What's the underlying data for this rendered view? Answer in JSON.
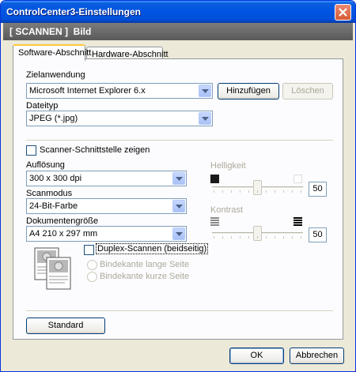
{
  "window": {
    "title": "ControlCenter3-Einstellungen",
    "close_icon": "close-icon"
  },
  "header": {
    "text": "[ SCANNEN ]  Bild"
  },
  "tabs": [
    {
      "label": "Software-Abschnitt",
      "active": true
    },
    {
      "label": "Hardware-Abschnitt",
      "active": false
    }
  ],
  "target_app": {
    "label": "Zielanwendung",
    "value": "Microsoft Internet Explorer 6.x",
    "add_button": "Hinzufügen",
    "delete_button": "Löschen"
  },
  "file_type": {
    "label": "Dateityp",
    "value": "JPEG (*.jpg)"
  },
  "show_scanner_interface": {
    "label": "Scanner-Schnittstelle zeigen",
    "checked": false
  },
  "resolution": {
    "label": "Auflösung",
    "value": "300 x 300 dpi"
  },
  "scan_mode": {
    "label": "Scanmodus",
    "value": "24-Bit-Farbe"
  },
  "document_size": {
    "label": "Dokumentengröße",
    "value": "A4 210 x 297 mm"
  },
  "brightness": {
    "label": "Helligkeit",
    "value": "50",
    "level": 0.5
  },
  "contrast": {
    "label": "Kontrast",
    "value": "50",
    "level": 0.5
  },
  "duplex": {
    "label": "Duplex-Scannen (beidseitig)",
    "checked": false,
    "options": [
      "Bindekante lange Seite",
      "Bindekante kurze Seite"
    ]
  },
  "buttons": {
    "default": "Standard",
    "ok": "OK",
    "cancel": "Abbrechen"
  }
}
